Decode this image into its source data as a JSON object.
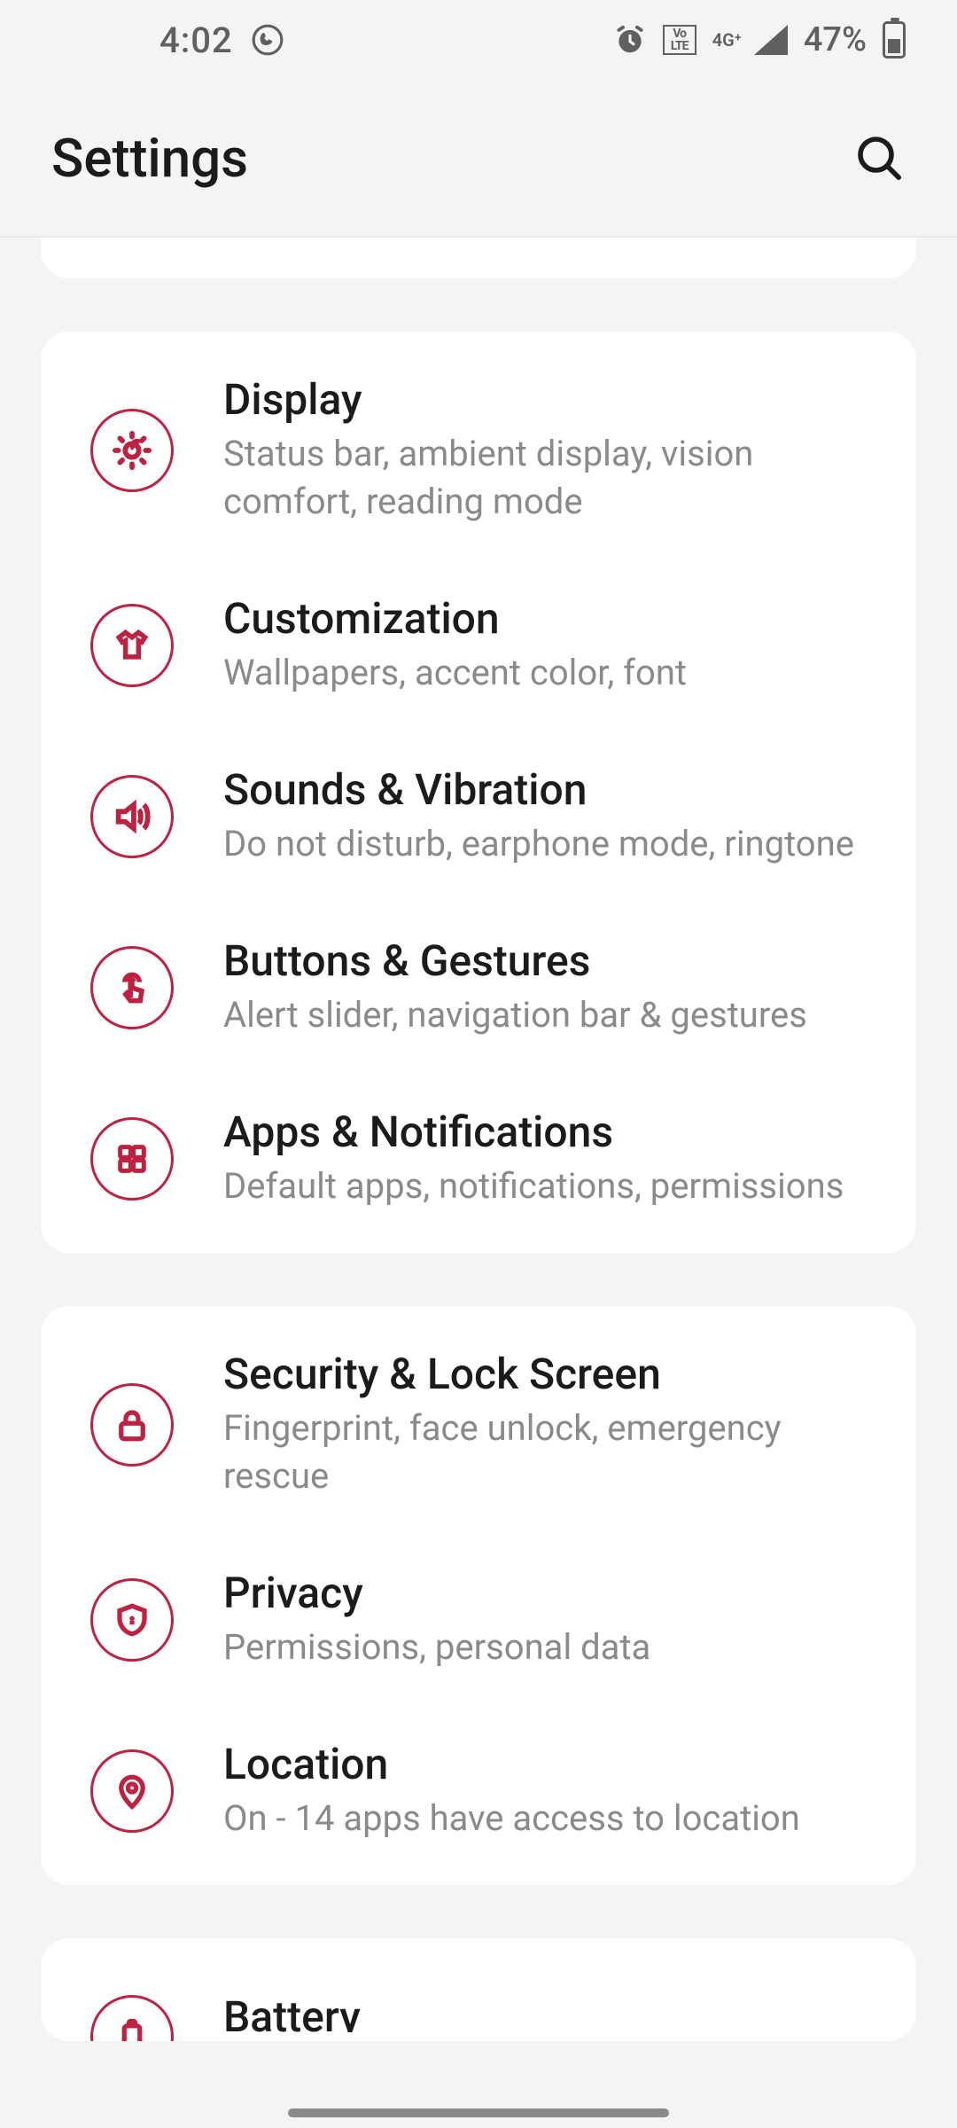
{
  "statusbar": {
    "time": "4:02",
    "network_label": "4G⁺",
    "lte_label_top": "Vo",
    "lte_label_bot": "LTE",
    "battery_pct": "47%"
  },
  "header": {
    "title": "Settings"
  },
  "accent_color": "#bf2140",
  "groups": [
    {
      "items": [
        {
          "icon": "brightness",
          "title": "Display",
          "sub": "Status bar, ambient display, vision comfort, reading mode"
        },
        {
          "icon": "shirt",
          "title": "Customization",
          "sub": "Wallpapers, accent color, font"
        },
        {
          "icon": "speaker",
          "title": "Sounds & Vibration",
          "sub": "Do not disturb, earphone mode, ringtone"
        },
        {
          "icon": "tap",
          "title": "Buttons & Gestures",
          "sub": "Alert slider, navigation bar & gestures"
        },
        {
          "icon": "apps",
          "title": "Apps & Notifications",
          "sub": "Default apps, notifications, permissions"
        }
      ]
    },
    {
      "items": [
        {
          "icon": "lock",
          "title": "Security & Lock Screen",
          "sub": "Fingerprint, face unlock, emergency rescue"
        },
        {
          "icon": "shield",
          "title": "Privacy",
          "sub": "Permissions, personal data"
        },
        {
          "icon": "pin",
          "title": "Location",
          "sub": "On - 14 apps have access to location"
        }
      ]
    },
    {
      "items": [
        {
          "icon": "battery",
          "title": "Battery",
          "sub": ""
        }
      ]
    }
  ],
  "icons": {
    "whatsapp": "whatsapp-icon",
    "alarm": "alarm-icon",
    "search": "search-icon"
  }
}
